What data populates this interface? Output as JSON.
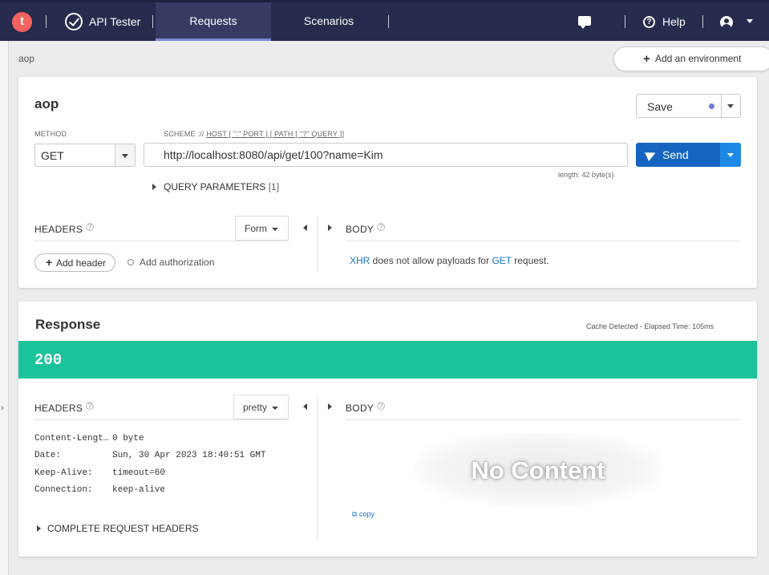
{
  "topbar": {
    "logo_letter": "t",
    "app_title": "API Tester",
    "tabs": [
      {
        "label": "Requests",
        "active": true
      },
      {
        "label": "Scenarios",
        "active": false
      }
    ],
    "help_label": "Help"
  },
  "left_strip": {
    "toggle_glyph": "›"
  },
  "breadcrumb": "aop",
  "env_button": {
    "label": "Add an environment"
  },
  "request": {
    "name": "aop",
    "save_label": "Save",
    "method_label": "METHOD",
    "method_value": "GET",
    "scheme_prefix": "SCHEME :// ",
    "scheme_link": "HOST [ \":\" PORT ] [ PATH [ \"?\" QUERY ]]",
    "url": "http://localhost:8080/api/get/100?name=Kim",
    "length_text": "length: 42 byte(s)",
    "send_label": "Send",
    "query_params_label": "QUERY PARAMETERS",
    "query_params_count": "[1]",
    "headers_title": "HEADERS",
    "headers_mode": "Form",
    "body_title": "BODY",
    "add_header_label": "Add header",
    "add_auth_label": "Add authorization",
    "body_note_link1": "XHR",
    "body_note_mid": " does not allow payloads for ",
    "body_note_link2": "GET",
    "body_note_end": " request."
  },
  "response": {
    "title": "Response",
    "meta": "Cache Detected - Elapsed Time: 105ms",
    "status": "200",
    "headers_title": "HEADERS",
    "headers_mode": "pretty",
    "body_title": "BODY",
    "headers": [
      {
        "key": "Content-Lengt…",
        "value": "0 byte"
      },
      {
        "key": "Date:",
        "value": "Sun, 30 Apr 2023 18:40:51 GMT"
      },
      {
        "key": "Keep-Alive:",
        "value": "timeout=60"
      },
      {
        "key": "Connection:",
        "value": "keep-alive"
      }
    ],
    "complete_headers_label": "COMPLETE REQUEST HEADERS",
    "no_content_label": "No Content",
    "copy_label": "copy"
  },
  "colors": {
    "topbar": "#272b4d",
    "accent": "#7f87d4",
    "status_ok": "#1bc39b",
    "send": "#1565c0",
    "logo": "#f0635e"
  },
  "icons": [
    "logo-icon",
    "check-badge-icon",
    "chat-icon",
    "help-icon",
    "user-icon",
    "chevron-down-icon",
    "send-plane-icon",
    "key-icon"
  ]
}
